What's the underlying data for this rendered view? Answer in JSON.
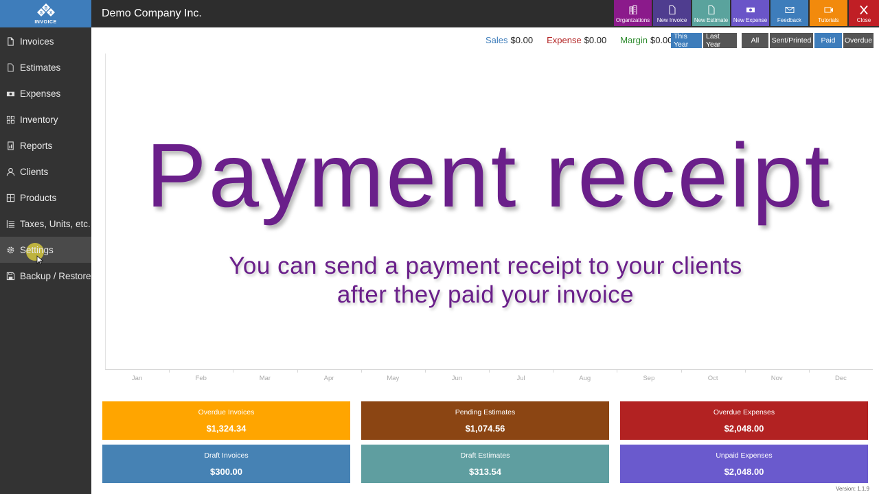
{
  "logo": {
    "letters": "SBX",
    "label": "INVOICE"
  },
  "sidebar": {
    "items": [
      {
        "label": "Invoices",
        "icon": "document-icon"
      },
      {
        "label": "Estimates",
        "icon": "document-outline-icon"
      },
      {
        "label": "Expenses",
        "icon": "cash-icon"
      },
      {
        "label": "Inventory",
        "icon": "grid-icon"
      },
      {
        "label": "Reports",
        "icon": "report-icon"
      },
      {
        "label": "Clients",
        "icon": "person-icon"
      },
      {
        "label": "Products",
        "icon": "box-icon"
      },
      {
        "label": "Taxes, Units, etc.",
        "icon": "list-icon"
      },
      {
        "label": "Settings",
        "icon": "gear-icon"
      },
      {
        "label": "Backup / Restore",
        "icon": "save-icon"
      }
    ],
    "active": "Settings"
  },
  "header": {
    "company": "Demo Company Inc.",
    "actions": [
      {
        "label": "Organizations",
        "icon": "building-icon",
        "color": "#8b1a8b"
      },
      {
        "label": "New Invoice",
        "icon": "document-icon",
        "color": "#4f3d8f"
      },
      {
        "label": "New Estimate",
        "icon": "document-icon",
        "color": "#5aa39d"
      },
      {
        "label": "New Expense",
        "icon": "cash-icon",
        "color": "#6a55c8"
      },
      {
        "label": "Feedback",
        "icon": "mail-icon",
        "color": "#3e7dbb"
      },
      {
        "label": "Tutorials",
        "icon": "video-icon",
        "color": "#f28a0c"
      },
      {
        "label": "Close",
        "icon": "close-icon",
        "color": "#c01f25"
      }
    ]
  },
  "summary": {
    "sales_label": "Sales",
    "sales_value": "$0.00",
    "expense_label": "Expense",
    "expense_value": "$0.00",
    "margin_label": "Margin",
    "margin_value": "$0.00"
  },
  "period_filter": {
    "this_year": "This Year",
    "last_year": "Last Year",
    "selected": "This Year"
  },
  "status_filter": {
    "all": "All",
    "sent": "Sent/Printed",
    "paid": "Paid",
    "overdue": "Overdue",
    "selected": "Paid"
  },
  "chart": {
    "months": [
      "Jan",
      "Feb",
      "Mar",
      "Apr",
      "May",
      "Jun",
      "Jul",
      "Aug",
      "Sep",
      "Oct",
      "Nov",
      "Dec"
    ]
  },
  "overlay": {
    "title": "Payment receipt",
    "line1": "You can send a payment receipt to your clients",
    "line2": "after they paid your invoice"
  },
  "cards": [
    {
      "title": "Overdue Invoices",
      "value": "$1,324.34",
      "color": "#ffa500"
    },
    {
      "title": "Pending Estimates",
      "value": "$1,074.56",
      "color": "#8b4513"
    },
    {
      "title": "Overdue Expenses",
      "value": "$2,048.00",
      "color": "#b22222"
    },
    {
      "title": "Draft Invoices",
      "value": "$300.00",
      "color": "#4682b4"
    },
    {
      "title": "Draft Estimates",
      "value": "$313.54",
      "color": "#5f9ea0"
    },
    {
      "title": "Unpaid Expenses",
      "value": "$2,048.00",
      "color": "#6a5acd"
    }
  ],
  "version": "Version: 1.1.9"
}
